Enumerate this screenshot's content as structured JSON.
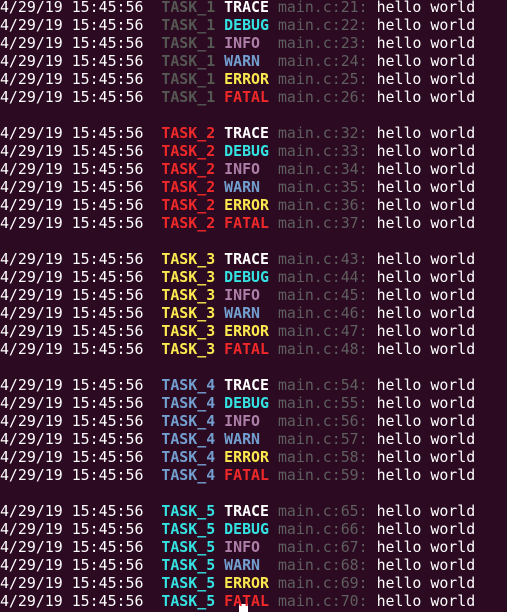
{
  "colors": {
    "background": "#2c0a21",
    "text": "#ffffff",
    "file_location": "#5f5f5f",
    "levels": {
      "TRACE": "#ffffff",
      "DEBUG": "#34e2e2",
      "INFO": "#ad7fa8",
      "WARN": "#729fcf",
      "ERROR": "#fce94f",
      "FATAL": "#ef2929"
    }
  },
  "groups": [
    {
      "task": "TASK_1",
      "task_color": "#555753",
      "lines": [
        {
          "date": "04/29/19",
          "time": "15:45:56",
          "level": "TRACE",
          "file": "main.c:21:",
          "message": "hello world"
        },
        {
          "date": "04/29/19",
          "time": "15:45:56",
          "level": "DEBUG",
          "file": "main.c:22:",
          "message": "hello world"
        },
        {
          "date": "04/29/19",
          "time": "15:45:56",
          "level": "INFO",
          "file": "main.c:23:",
          "message": "hello world"
        },
        {
          "date": "04/29/19",
          "time": "15:45:56",
          "level": "WARN",
          "file": "main.c:24:",
          "message": "hello world"
        },
        {
          "date": "04/29/19",
          "time": "15:45:56",
          "level": "ERROR",
          "file": "main.c:25:",
          "message": "hello world"
        },
        {
          "date": "04/29/19",
          "time": "15:45:56",
          "level": "FATAL",
          "file": "main.c:26:",
          "message": "hello world"
        }
      ]
    },
    {
      "task": "TASK_2",
      "task_color": "#ef2929",
      "lines": [
        {
          "date": "04/29/19",
          "time": "15:45:56",
          "level": "TRACE",
          "file": "main.c:32:",
          "message": "hello world"
        },
        {
          "date": "04/29/19",
          "time": "15:45:56",
          "level": "DEBUG",
          "file": "main.c:33:",
          "message": "hello world"
        },
        {
          "date": "04/29/19",
          "time": "15:45:56",
          "level": "INFO",
          "file": "main.c:34:",
          "message": "hello world"
        },
        {
          "date": "04/29/19",
          "time": "15:45:56",
          "level": "WARN",
          "file": "main.c:35:",
          "message": "hello world"
        },
        {
          "date": "04/29/19",
          "time": "15:45:56",
          "level": "ERROR",
          "file": "main.c:36:",
          "message": "hello world"
        },
        {
          "date": "04/29/19",
          "time": "15:45:56",
          "level": "FATAL",
          "file": "main.c:37:",
          "message": "hello world"
        }
      ]
    },
    {
      "task": "TASK_3",
      "task_color": "#fce94f",
      "lines": [
        {
          "date": "04/29/19",
          "time": "15:45:56",
          "level": "TRACE",
          "file": "main.c:43:",
          "message": "hello world"
        },
        {
          "date": "04/29/19",
          "time": "15:45:56",
          "level": "DEBUG",
          "file": "main.c:44:",
          "message": "hello world"
        },
        {
          "date": "04/29/19",
          "time": "15:45:56",
          "level": "INFO",
          "file": "main.c:45:",
          "message": "hello world"
        },
        {
          "date": "04/29/19",
          "time": "15:45:56",
          "level": "WARN",
          "file": "main.c:46:",
          "message": "hello world"
        },
        {
          "date": "04/29/19",
          "time": "15:45:56",
          "level": "ERROR",
          "file": "main.c:47:",
          "message": "hello world"
        },
        {
          "date": "04/29/19",
          "time": "15:45:56",
          "level": "FATAL",
          "file": "main.c:48:",
          "message": "hello world"
        }
      ]
    },
    {
      "task": "TASK_4",
      "task_color": "#729fcf",
      "lines": [
        {
          "date": "04/29/19",
          "time": "15:45:56",
          "level": "TRACE",
          "file": "main.c:54:",
          "message": "hello world"
        },
        {
          "date": "04/29/19",
          "time": "15:45:56",
          "level": "DEBUG",
          "file": "main.c:55:",
          "message": "hello world"
        },
        {
          "date": "04/29/19",
          "time": "15:45:56",
          "level": "INFO",
          "file": "main.c:56:",
          "message": "hello world"
        },
        {
          "date": "04/29/19",
          "time": "15:45:56",
          "level": "WARN",
          "file": "main.c:57:",
          "message": "hello world"
        },
        {
          "date": "04/29/19",
          "time": "15:45:56",
          "level": "ERROR",
          "file": "main.c:58:",
          "message": "hello world"
        },
        {
          "date": "04/29/19",
          "time": "15:45:56",
          "level": "FATAL",
          "file": "main.c:59:",
          "message": "hello world"
        }
      ]
    },
    {
      "task": "TASK_5",
      "task_color": "#34e2e2",
      "lines": [
        {
          "date": "04/29/19",
          "time": "15:45:56",
          "level": "TRACE",
          "file": "main.c:65:",
          "message": "hello world"
        },
        {
          "date": "04/29/19",
          "time": "15:45:56",
          "level": "DEBUG",
          "file": "main.c:66:",
          "message": "hello world"
        },
        {
          "date": "04/29/19",
          "time": "15:45:56",
          "level": "INFO",
          "file": "main.c:67:",
          "message": "hello world"
        },
        {
          "date": "04/29/19",
          "time": "15:45:56",
          "level": "WARN",
          "file": "main.c:68:",
          "message": "hello world"
        },
        {
          "date": "04/29/19",
          "time": "15:45:56",
          "level": "ERROR",
          "file": "main.c:69:",
          "message": "hello world"
        },
        {
          "date": "04/29/19",
          "time": "15:45:56",
          "level": "FATAL",
          "file": "main.c:70:",
          "message": "hello world"
        }
      ]
    }
  ]
}
